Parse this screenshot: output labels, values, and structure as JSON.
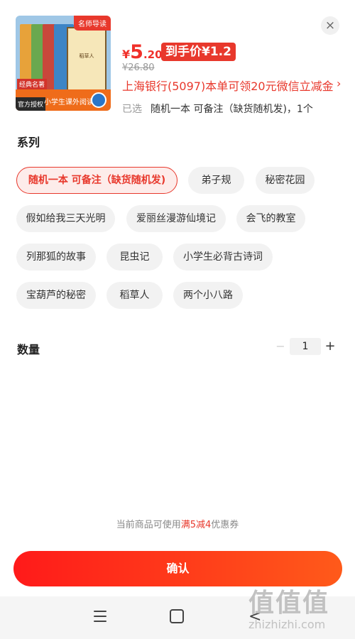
{
  "product": {
    "thumb": {
      "tag": "名师导读",
      "cover_title": "稻草人",
      "classic_badge": "经典名著",
      "official_badge": "官方授权",
      "series_text": "小学生课外阅读"
    },
    "price_currency": "¥",
    "price_integer": "5",
    "price_decimal": ".20",
    "net_price_label": "到手价¥1.2",
    "original_price": "¥26.80",
    "bank_promo": "上海银行(5097)本单可领20元微信立减金",
    "selected_label": "已选",
    "selected_value": "随机一本 可备注（缺货随机发)，1个"
  },
  "series": {
    "title": "系列",
    "options": [
      {
        "label": "随机一本 可备注（缺货随机发)",
        "active": true
      },
      {
        "label": "弟子规",
        "active": false
      },
      {
        "label": "秘密花园",
        "active": false
      },
      {
        "label": "假如给我三天光明",
        "active": false
      },
      {
        "label": "爱丽丝漫游仙境记",
        "active": false
      },
      {
        "label": "会飞的教室",
        "active": false
      },
      {
        "label": "列那狐的故事",
        "active": false
      },
      {
        "label": "昆虫记",
        "active": false
      },
      {
        "label": "小学生必背古诗词",
        "active": false
      },
      {
        "label": "宝葫芦的秘密",
        "active": false
      },
      {
        "label": "稻草人",
        "active": false
      },
      {
        "label": "两个小八路",
        "active": false
      }
    ]
  },
  "quantity": {
    "title": "数量",
    "minus": "−",
    "value": "1",
    "plus": "+"
  },
  "coupon_note": {
    "prefix": "当前商品可使用",
    "highlight": "满5减4",
    "suffix": "优惠券"
  },
  "confirm_label": "确认",
  "close_label": "×",
  "bank_arrow": "›",
  "nav": {
    "back": "<"
  },
  "watermark": {
    "logo": "值值值",
    "url": "zhizhizhi.com"
  },
  "colors": {
    "accent": "#e8382c",
    "button_start": "#ff1a1a",
    "button_end": "#ff5a1a"
  }
}
